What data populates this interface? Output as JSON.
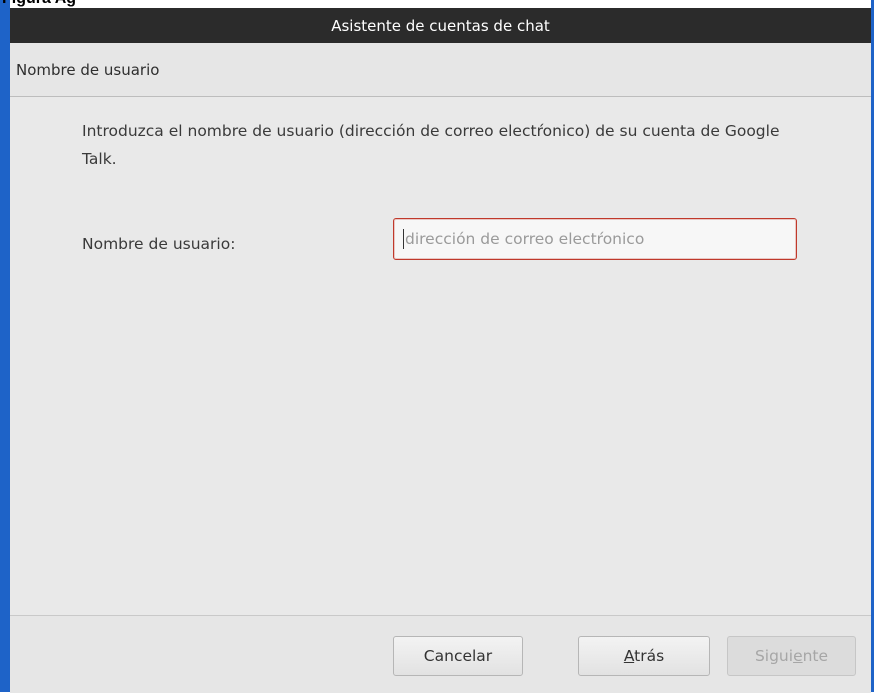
{
  "window": {
    "title": "Asistente de cuentas de chat",
    "header": "Nombre de usuario"
  },
  "main": {
    "intro_text": "Introduzca el nombre de usuario (dirección de correo electŕonico) de su cuenta de Google Talk.",
    "username_label": "Nombre de usuario:",
    "username_value": "",
    "username_placeholder": "dirección de correo electŕonico"
  },
  "footer": {
    "cancel_label": "Cancelar",
    "back_label": "Atrás",
    "next_label": "Siguiente"
  },
  "colors": {
    "titlebar_bg": "#2b2b2b",
    "window_bg": "#e9e9e9",
    "input_focus_border": "#c0392b",
    "frame_blue": "#1e63c8"
  }
}
